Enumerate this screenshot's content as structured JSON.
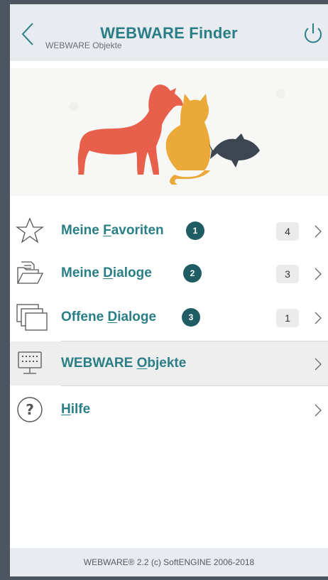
{
  "header": {
    "title": "WEBWARE Finder",
    "subtitle": "WEBWARE Objekte"
  },
  "menu": [
    {
      "pre": "Meine ",
      "accel": "F",
      "post": "avoriten",
      "step": "1",
      "count": "4",
      "icon": "star-icon"
    },
    {
      "pre": "Meine ",
      "accel": "D",
      "post": "ialoge",
      "step": "2",
      "count": "3",
      "icon": "folder-icon"
    },
    {
      "pre": "Offene ",
      "accel": "D",
      "post": "ialoge",
      "step": "3",
      "count": "1",
      "icon": "windows-icon"
    },
    {
      "pre": "WEBWARE ",
      "accel": "O",
      "post": "bjekte",
      "icon": "monitor-icon"
    },
    {
      "pre": "",
      "accel": "H",
      "post": "ilfe",
      "icon": "help-icon"
    }
  ],
  "footer": {
    "text": "WEBWARE® 2.2 (c) SoftENGINE 2006-2018"
  },
  "colors": {
    "accent": "#2a7f86",
    "badge": "#1f5c63",
    "dog": "#e8604c",
    "cat": "#eba93a",
    "fish": "#3d4650"
  }
}
